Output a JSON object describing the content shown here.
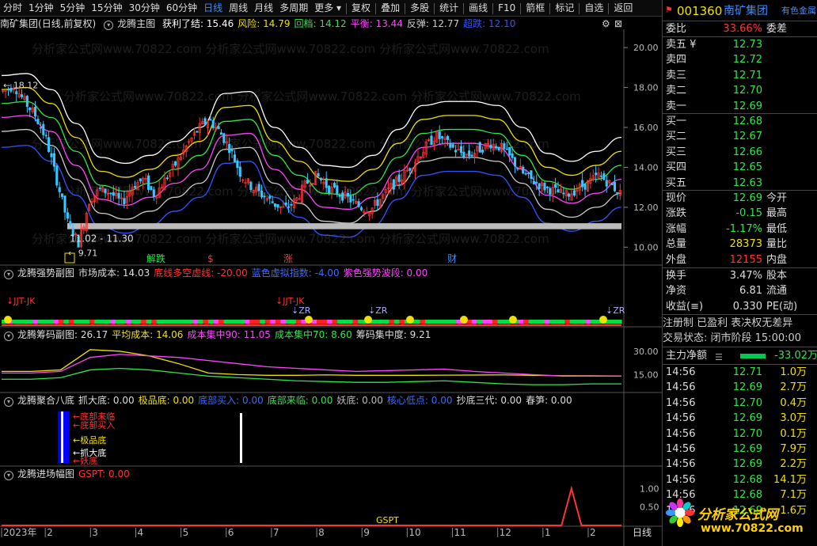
{
  "toolbar": {
    "periods": [
      "分时",
      "1分钟",
      "5分钟",
      "15分钟",
      "30分钟",
      "60分钟",
      "日线",
      "周线",
      "月线",
      "多周期",
      "更多"
    ],
    "selected": "日线",
    "tools": [
      "复权",
      "叠加",
      "多股",
      "统计",
      "画线",
      "F10",
      "箭框",
      "标记",
      "自选",
      "返回"
    ]
  },
  "main_panel": {
    "stock": "南矿集团",
    "mode": "(日线,前复权)",
    "indicator": "龙腾主图",
    "labels": [
      {
        "text": "获利了结: 15.46",
        "color": "#ffffff"
      },
      {
        "text": "风险: 14.79",
        "color": "#f0e000"
      },
      {
        "text": "回档: 14.12",
        "color": "#2ee64a"
      },
      {
        "text": "平衡: 13.44",
        "color": "#ff44ff"
      },
      {
        "text": "反弹: 12.77",
        "color": "#cccccc"
      },
      {
        "text": "超跌: 12.10",
        "color": "#3355ff"
      }
    ],
    "annot_high": "18.12",
    "annot_low": "9.71",
    "range_label": "11.02 - 11.30",
    "markers": [
      "解跌",
      "$",
      "涨",
      "财"
    ]
  },
  "sub1": {
    "name": "龙腾强势副图",
    "labels": [
      {
        "text": "市场成本: 14.03",
        "color": "#dddddd"
      },
      {
        "text": "底线多空虚线: -20.00",
        "color": "#ff3333"
      },
      {
        "text": "蓝色虚拟指数: -4.00",
        "color": "#3b6bff"
      },
      {
        "text": "紫色强势波段: 0.00",
        "color": "#ff44ff"
      }
    ],
    "tags": [
      "JJT-JK",
      "JJT-JK",
      "ZR",
      "ZR",
      "ZR"
    ]
  },
  "sub2": {
    "name": "龙腾筹码副图",
    "labels": [
      {
        "text": ": 26.17",
        "color": "#dddddd"
      },
      {
        "text": "平均成本: 14.06",
        "color": "#f0e000"
      },
      {
        "text": "成本集中90: 11.05",
        "color": "#ff44ff"
      },
      {
        "text": "成本集中70: 8.60",
        "color": "#2ee64a"
      },
      {
        "text": "筹码集中度: 9.21",
        "color": "#dddddd"
      }
    ]
  },
  "sub3": {
    "name": "龙腾聚合八底",
    "labels": [
      {
        "text": "抓大底: 0.00",
        "color": "#dddddd"
      },
      {
        "text": "极品底: 0.00",
        "color": "#f0e000"
      },
      {
        "text": "底部买入: 0.00",
        "color": "#3b6bff"
      },
      {
        "text": "底部来临: 0.00",
        "color": "#2ee64a"
      },
      {
        "text": "妖底: 0.00",
        "color": "#bbbbbb"
      },
      {
        "text": "核心低点: 0.00",
        "color": "#3b6bff"
      },
      {
        "text": "抄底三代: 0.00",
        "color": "#dddddd"
      },
      {
        "text": "春笋: 0.00",
        "color": "#dddddd"
      }
    ],
    "tags": [
      "底部来临",
      "底部买入",
      "极品底",
      "抓大底",
      "妖底"
    ]
  },
  "sub4": {
    "name": "龙腾进场幅图",
    "labels": [
      {
        "text": "GSPT: 0.00",
        "color": "#ff3333"
      }
    ],
    "tag": "GSPT"
  },
  "xaxis": {
    "months": [
      "2023年",
      "2",
      "3",
      "4",
      "5",
      "6",
      "7",
      "8",
      "9",
      "10",
      "11",
      "12",
      "1",
      "2"
    ],
    "period_tab": "日线"
  },
  "quote": {
    "code": "001360",
    "name": "南矿集团",
    "sector": "有色金属",
    "weibi_label": "委比",
    "weibi": "33.66%",
    "weicha_label": "委差",
    "asks": [
      {
        "label": "卖五 ¥",
        "price": "12.73"
      },
      {
        "label": "卖四",
        "price": "12.72"
      },
      {
        "label": "卖三",
        "price": "12.71"
      },
      {
        "label": "卖二",
        "price": "12.70"
      },
      {
        "label": "卖一",
        "price": "12.69"
      }
    ],
    "bids": [
      {
        "label": "买一",
        "price": "12.68"
      },
      {
        "label": "买二",
        "price": "12.67"
      },
      {
        "label": "买三",
        "price": "12.66"
      },
      {
        "label": "买四",
        "price": "12.65"
      },
      {
        "label": "买五",
        "price": "12.63"
      }
    ],
    "stats": [
      {
        "label": "现价",
        "value": "12.69",
        "color": "#2ee64a",
        "right": "今开"
      },
      {
        "label": "涨跌",
        "value": "-0.15",
        "color": "#2ee64a",
        "right": "最高"
      },
      {
        "label": "涨幅",
        "value": "-1.17%",
        "color": "#2ee64a",
        "right": "最低"
      },
      {
        "label": "总量",
        "value": "28373",
        "color": "#f0e000",
        "right": "量比"
      },
      {
        "label": "外盘",
        "value": "12155",
        "color": "#ff3333",
        "right": "内盘"
      }
    ],
    "stats2": [
      {
        "label": "换手",
        "value": "3.47%",
        "right": "股本"
      },
      {
        "label": "净资",
        "value": "6.81",
        "right": "流通"
      },
      {
        "label": "收益(≡)",
        "value": "0.330",
        "right": "PE(动)"
      }
    ],
    "status_line": "注册制 已盈利 表决权无差异",
    "trade_state": "交易状态: 闭市阶段 15:00:00",
    "netflow_label": "主力净额",
    "netflow": "-33.02万",
    "ticks": [
      {
        "time": "14:56",
        "price": "12.71",
        "vol": "1.0万"
      },
      {
        "time": "14:56",
        "price": "12.69",
        "vol": "2.7万"
      },
      {
        "time": "14:56",
        "price": "12.70",
        "vol": "0.4万"
      },
      {
        "time": "14:56",
        "price": "12.69",
        "vol": "3.0万"
      },
      {
        "time": "14:56",
        "price": "12.70",
        "vol": "0.1万"
      },
      {
        "time": "14:56",
        "price": "12.69",
        "vol": "7.9万"
      },
      {
        "time": "14:56",
        "price": "12.69",
        "vol": "2.2万"
      },
      {
        "time": "14:56",
        "price": "12.68",
        "vol": "14.1万"
      },
      {
        "time": "14:56",
        "price": "12.68",
        "vol": "7.1万"
      },
      {
        "time": "14:56",
        "price": "12.69",
        "vol": "1.6万"
      }
    ],
    "watermark": "分析家公式网",
    "watermark_url": "www.70822.com"
  },
  "chart_data": [
    {
      "type": "candlestick",
      "title": "龙腾主图",
      "y_ticks": [
        "20.00",
        "18.00",
        "16.00",
        "14.00",
        "12.00",
        "10.00"
      ],
      "ylim": [
        9.3,
        20.6
      ],
      "x_months": [
        "2023年",
        "2",
        "3",
        "4",
        "5",
        "6",
        "7",
        "8",
        "9",
        "10",
        "11",
        "12",
        "1",
        "2"
      ],
      "bands": [
        {
          "name": "获利了结",
          "color": "#ffffff",
          "values": [
            18.6,
            18.7,
            17.9,
            16.2,
            14.5,
            14.2,
            14.6,
            15.3,
            16.0,
            17.7,
            17.8,
            16.0,
            15.0,
            14.1,
            14.0,
            14.6,
            15.9,
            17.1,
            17.3,
            17.3,
            17.1,
            16.0,
            14.7,
            14.3,
            14.8,
            15.5
          ]
        },
        {
          "name": "风险",
          "color": "#f0e000",
          "values": [
            17.9,
            18.0,
            17.2,
            15.5,
            13.8,
            13.5,
            13.9,
            14.6,
            15.3,
            17.0,
            17.1,
            15.3,
            14.3,
            13.4,
            13.3,
            13.9,
            15.2,
            16.4,
            16.6,
            16.6,
            16.4,
            15.3,
            14.0,
            13.6,
            14.1,
            14.8
          ]
        },
        {
          "name": "回档",
          "color": "#2ee64a",
          "values": [
            17.2,
            17.3,
            16.5,
            14.8,
            13.1,
            12.8,
            13.2,
            13.9,
            14.6,
            16.3,
            16.4,
            14.6,
            13.6,
            12.7,
            12.6,
            13.2,
            14.5,
            15.7,
            15.9,
            15.9,
            15.7,
            14.6,
            13.3,
            12.9,
            13.4,
            14.1
          ]
        },
        {
          "name": "平衡",
          "color": "#ff44ff",
          "values": [
            16.5,
            16.6,
            15.8,
            14.1,
            12.4,
            12.1,
            12.5,
            13.2,
            13.9,
            15.6,
            15.7,
            13.9,
            12.9,
            12.0,
            11.9,
            12.5,
            13.8,
            15.0,
            15.2,
            15.2,
            15.0,
            13.9,
            12.6,
            12.2,
            12.7,
            13.4
          ]
        },
        {
          "name": "反弹",
          "color": "#cccccc",
          "values": [
            15.8,
            15.9,
            15.1,
            13.4,
            11.7,
            11.4,
            11.8,
            12.5,
            13.2,
            14.9,
            15.0,
            13.2,
            12.2,
            11.3,
            11.2,
            11.8,
            13.1,
            14.3,
            14.5,
            14.5,
            14.3,
            13.2,
            11.9,
            11.5,
            12.0,
            12.7
          ]
        },
        {
          "name": "超跌",
          "color": "#3355ff",
          "values": [
            15.0,
            15.1,
            14.3,
            12.6,
            11.0,
            10.7,
            11.1,
            11.8,
            12.5,
            14.2,
            14.3,
            12.5,
            11.5,
            10.6,
            10.5,
            11.1,
            12.4,
            13.6,
            13.8,
            13.8,
            13.6,
            12.5,
            11.2,
            10.8,
            11.3,
            12.0
          ]
        }
      ],
      "price_path": [
        17.8,
        18.1,
        17.3,
        16.6,
        15.4,
        13.3,
        11.2,
        10.2,
        12.4,
        12.9,
        12.7,
        12.2,
        13.1,
        13.4,
        12.6,
        13.4,
        14.2,
        15.1,
        15.9,
        16.4,
        15.8,
        14.9,
        13.6,
        13.0,
        12.6,
        12.2,
        11.9,
        12.3,
        13.2,
        13.6,
        13.0,
        12.7,
        12.4,
        12.0,
        11.9,
        12.5,
        13.1,
        13.6,
        14.3,
        15.0,
        15.6,
        15.2,
        14.8,
        14.6,
        14.9,
        15.2,
        15.0,
        14.4,
        13.7,
        13.3,
        13.0,
        12.8,
        12.6,
        12.9,
        13.2,
        13.6,
        13.2,
        12.7
      ],
      "range_bar": [
        10.9,
        11.2
      ]
    },
    {
      "type": "line",
      "title": "龙腾筹码副图",
      "y_ticks": [
        "30.00",
        "15.00"
      ],
      "ylim": [
        4,
        36
      ],
      "series": [
        {
          "name": "平均成本",
          "color": "#f0e000",
          "values": [
            17,
            17,
            18,
            31,
            30,
            27,
            22,
            16,
            15,
            14.5,
            14.5,
            14.8,
            14.5,
            14.5,
            14.5,
            14.6,
            14.7,
            14.8,
            14.5,
            14.3,
            14.2,
            14.1
          ]
        },
        {
          "name": "成本集中90",
          "color": "#ff44ff",
          "values": [
            16,
            16,
            17,
            26,
            28,
            27,
            26,
            24,
            22,
            20,
            19,
            18,
            17,
            17.5,
            18,
            18.5,
            17,
            16,
            15,
            14,
            14,
            14
          ]
        },
        {
          "name": "成本集中70",
          "color": "#2ee64a",
          "values": [
            12,
            12,
            13,
            18,
            19,
            18,
            16,
            14,
            13,
            12,
            11,
            10.5,
            10,
            10,
            10.5,
            11,
            10,
            9,
            8.5,
            8.5,
            9,
            9
          ]
        }
      ]
    },
    {
      "type": "line",
      "title": "龙腾进场幅图",
      "y_ticks": [
        "1.00",
        "0.50"
      ],
      "ylim": [
        0,
        1.2
      ],
      "series": [
        {
          "name": "GSPT",
          "color": "#ff3333",
          "values": [
            0,
            0,
            0,
            0,
            0,
            0,
            0,
            0,
            0,
            0,
            0,
            0,
            0,
            0,
            0,
            0,
            0,
            0,
            0,
            0,
            0,
            0,
            0,
            0,
            0,
            0,
            0,
            0,
            0,
            0,
            0,
            0,
            0,
            0,
            0,
            0,
            0,
            0,
            0,
            0,
            0,
            0,
            0,
            0,
            0,
            0,
            0,
            0,
            0,
            0,
            0,
            0,
            0,
            0,
            0,
            0,
            0,
            1.0,
            0,
            0,
            0,
            0,
            0
          ]
        }
      ]
    }
  ]
}
